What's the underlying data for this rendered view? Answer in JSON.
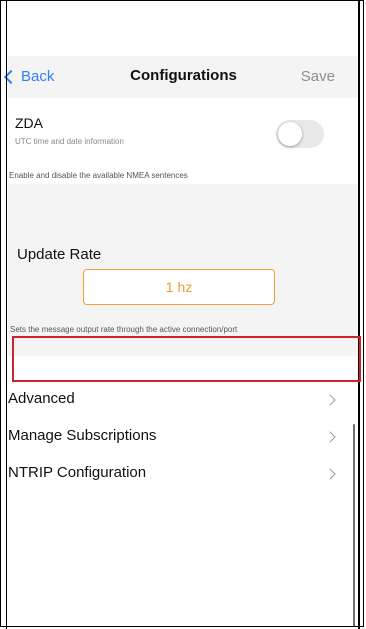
{
  "nav": {
    "back_label": "Back",
    "title": "Configurations",
    "save_label": "Save"
  },
  "zda": {
    "title": "ZDA",
    "subtitle": "UTC time and date information",
    "enabled": false
  },
  "nmea_help": "Enable and disable the available NMEA sentences",
  "update_rate": {
    "label": "Update Rate",
    "value": "1 hz",
    "help": "Sets the message output rate through the active connection/port"
  },
  "list": [
    {
      "label": "Advanced"
    },
    {
      "label": "Manage Subscriptions"
    },
    {
      "label": "NTRIP Configuration"
    }
  ],
  "colors": {
    "accent": "#2f7ff6",
    "rate": "#f39c32",
    "highlight": "#d0222a"
  }
}
